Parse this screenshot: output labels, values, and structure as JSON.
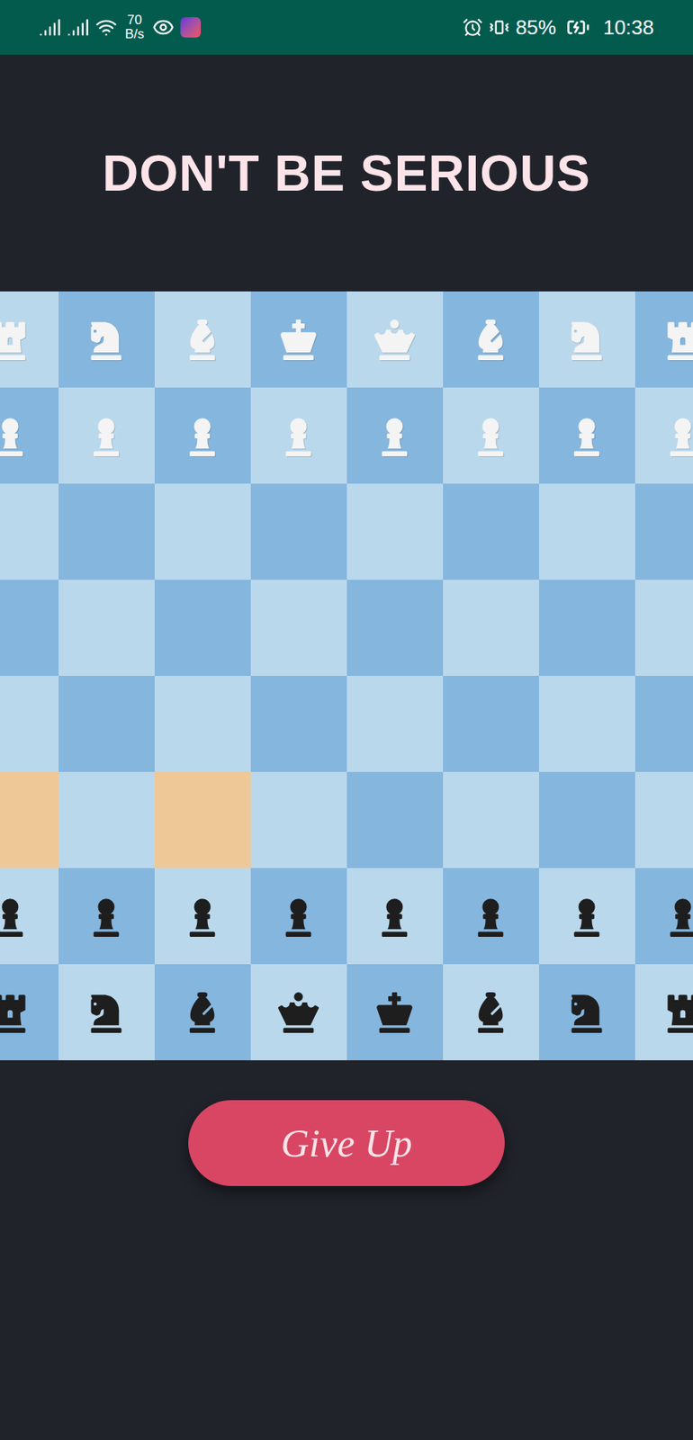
{
  "status_bar": {
    "speed_value": "70",
    "speed_unit": "B/s",
    "battery": "85%",
    "time": "10:38"
  },
  "title": "DON'T BE SERIOUS",
  "board": {
    "rows": [
      [
        {
          "piece": "rook",
          "side": "white",
          "highlighted": false
        },
        {
          "piece": "knight",
          "side": "white",
          "highlighted": false
        },
        {
          "piece": "bishop",
          "side": "white",
          "highlighted": false
        },
        {
          "piece": "king",
          "side": "white",
          "highlighted": false
        },
        {
          "piece": "queen",
          "side": "white",
          "highlighted": false
        },
        {
          "piece": "bishop",
          "side": "white",
          "highlighted": false
        },
        {
          "piece": "knight",
          "side": "white",
          "highlighted": false
        },
        {
          "piece": "rook",
          "side": "white",
          "highlighted": false
        }
      ],
      [
        {
          "piece": "pawn",
          "side": "white",
          "highlighted": false
        },
        {
          "piece": "pawn",
          "side": "white",
          "highlighted": false
        },
        {
          "piece": "pawn",
          "side": "white",
          "highlighted": false
        },
        {
          "piece": "pawn",
          "side": "white",
          "highlighted": false
        },
        {
          "piece": "pawn",
          "side": "white",
          "highlighted": false
        },
        {
          "piece": "pawn",
          "side": "white",
          "highlighted": false
        },
        {
          "piece": "pawn",
          "side": "white",
          "highlighted": false
        },
        {
          "piece": "pawn",
          "side": "white",
          "highlighted": false
        }
      ],
      [
        {
          "piece": null,
          "side": null,
          "highlighted": false
        },
        {
          "piece": null,
          "side": null,
          "highlighted": false
        },
        {
          "piece": null,
          "side": null,
          "highlighted": false
        },
        {
          "piece": null,
          "side": null,
          "highlighted": false
        },
        {
          "piece": null,
          "side": null,
          "highlighted": false
        },
        {
          "piece": null,
          "side": null,
          "highlighted": false
        },
        {
          "piece": null,
          "side": null,
          "highlighted": false
        },
        {
          "piece": null,
          "side": null,
          "highlighted": false
        }
      ],
      [
        {
          "piece": null,
          "side": null,
          "highlighted": false
        },
        {
          "piece": null,
          "side": null,
          "highlighted": false
        },
        {
          "piece": null,
          "side": null,
          "highlighted": false
        },
        {
          "piece": null,
          "side": null,
          "highlighted": false
        },
        {
          "piece": null,
          "side": null,
          "highlighted": false
        },
        {
          "piece": null,
          "side": null,
          "highlighted": false
        },
        {
          "piece": null,
          "side": null,
          "highlighted": false
        },
        {
          "piece": null,
          "side": null,
          "highlighted": false
        }
      ],
      [
        {
          "piece": null,
          "side": null,
          "highlighted": false
        },
        {
          "piece": null,
          "side": null,
          "highlighted": false
        },
        {
          "piece": null,
          "side": null,
          "highlighted": false
        },
        {
          "piece": null,
          "side": null,
          "highlighted": false
        },
        {
          "piece": null,
          "side": null,
          "highlighted": false
        },
        {
          "piece": null,
          "side": null,
          "highlighted": false
        },
        {
          "piece": null,
          "side": null,
          "highlighted": false
        },
        {
          "piece": null,
          "side": null,
          "highlighted": false
        }
      ],
      [
        {
          "piece": null,
          "side": null,
          "highlighted": true
        },
        {
          "piece": null,
          "side": null,
          "highlighted": false
        },
        {
          "piece": null,
          "side": null,
          "highlighted": true
        },
        {
          "piece": null,
          "side": null,
          "highlighted": false
        },
        {
          "piece": null,
          "side": null,
          "highlighted": false
        },
        {
          "piece": null,
          "side": null,
          "highlighted": false
        },
        {
          "piece": null,
          "side": null,
          "highlighted": false
        },
        {
          "piece": null,
          "side": null,
          "highlighted": false
        }
      ],
      [
        {
          "piece": "pawn",
          "side": "black",
          "highlighted": false
        },
        {
          "piece": "pawn",
          "side": "black",
          "highlighted": false
        },
        {
          "piece": "pawn",
          "side": "black",
          "highlighted": false
        },
        {
          "piece": "pawn",
          "side": "black",
          "highlighted": false
        },
        {
          "piece": "pawn",
          "side": "black",
          "highlighted": false
        },
        {
          "piece": "pawn",
          "side": "black",
          "highlighted": false
        },
        {
          "piece": "pawn",
          "side": "black",
          "highlighted": false
        },
        {
          "piece": "pawn",
          "side": "black",
          "highlighted": false
        }
      ],
      [
        {
          "piece": "rook",
          "side": "black",
          "highlighted": false
        },
        {
          "piece": "knight",
          "side": "black",
          "highlighted": false
        },
        {
          "piece": "bishop",
          "side": "black",
          "highlighted": false
        },
        {
          "piece": "queen",
          "side": "black",
          "highlighted": false
        },
        {
          "piece": "king",
          "side": "black",
          "highlighted": false
        },
        {
          "piece": "bishop",
          "side": "black",
          "highlighted": false
        },
        {
          "piece": "knight",
          "side": "black",
          "highlighted": false
        },
        {
          "piece": "rook",
          "side": "black",
          "highlighted": false
        }
      ]
    ]
  },
  "buttons": [
    "Give Up"
  ]
}
